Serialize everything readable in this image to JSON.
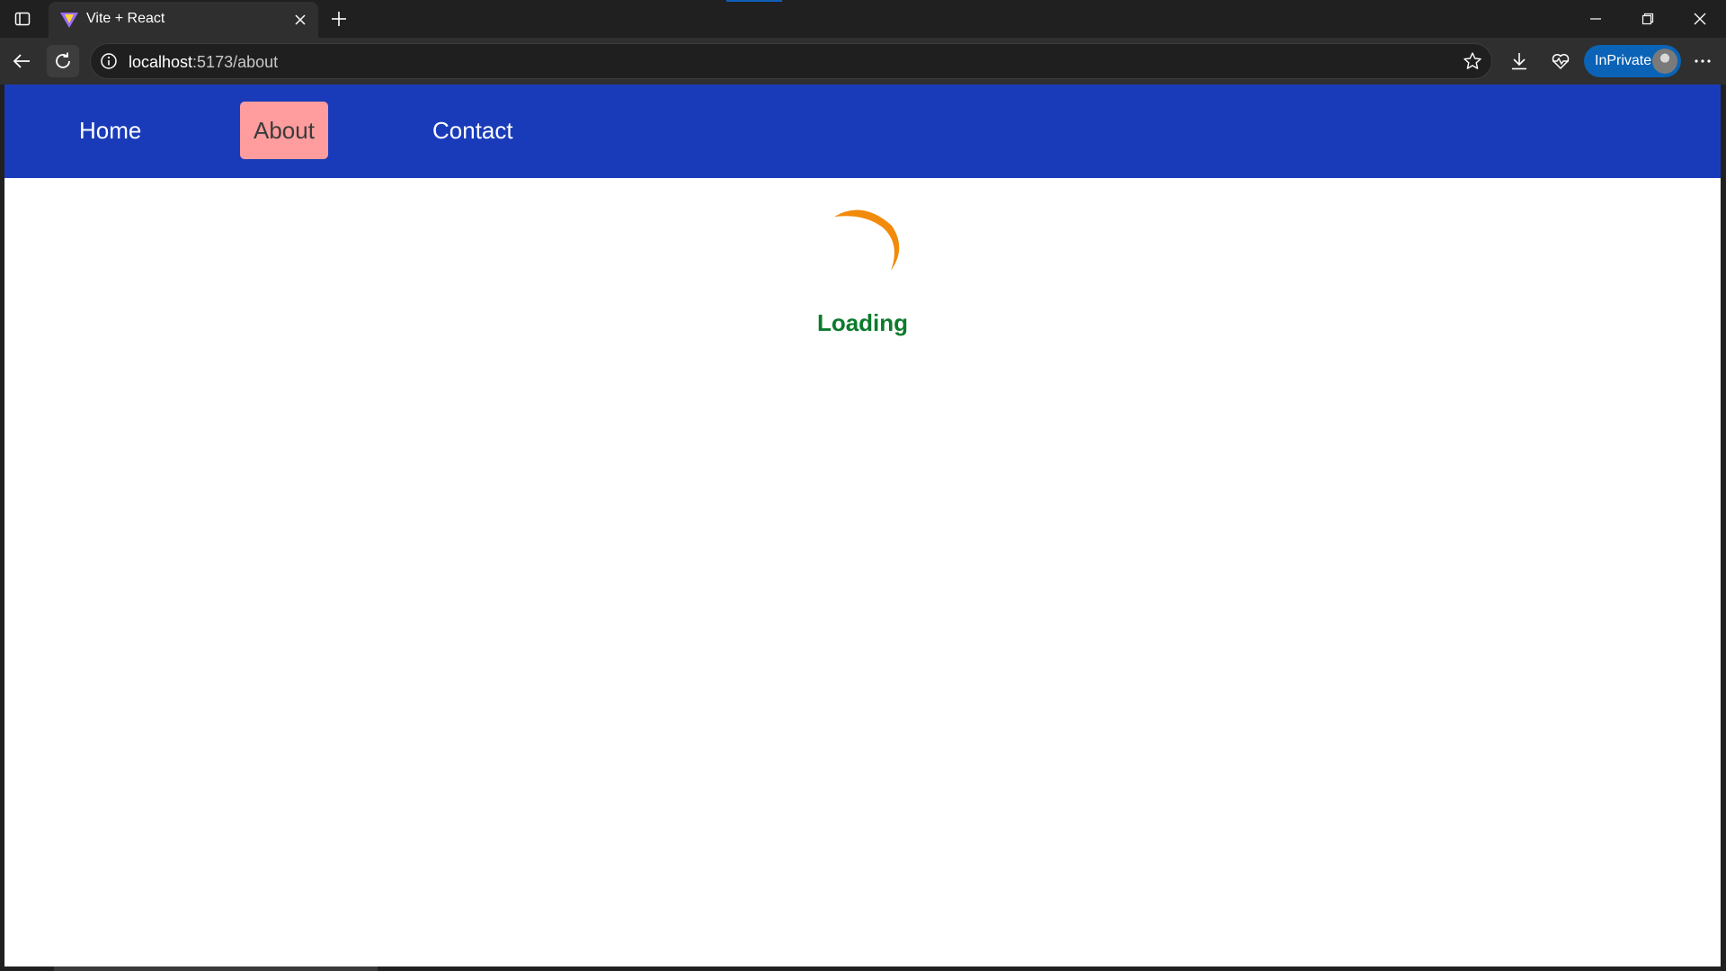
{
  "browser": {
    "tab": {
      "title": "Vite + React"
    },
    "address_bar": {
      "host": "localhost",
      "path": ":5173/about"
    },
    "profile": {
      "label": "InPrivate"
    }
  },
  "page": {
    "nav": {
      "items": [
        {
          "label": "Home",
          "active": false
        },
        {
          "label": "About",
          "active": true
        },
        {
          "label": "Contact",
          "active": false
        }
      ]
    },
    "status": {
      "loading_text": "Loading"
    }
  },
  "colors": {
    "nav_background": "#1a3bb9",
    "active_nav_item": "#ff9d9e",
    "spinner": "#f28a0a",
    "loading_text": "#0b7a2c",
    "inprivate_badge": "#0a63b6"
  },
  "icons": {
    "tab_actions": "tab-actions-icon",
    "favicon": "vite-logo-icon",
    "tab_close": "close-icon",
    "new_tab": "plus-icon",
    "back": "back-arrow-icon",
    "reload": "reload-icon",
    "site_info": "info-icon",
    "favorite": "star-icon",
    "downloads": "download-icon",
    "performance": "heartbeat-icon",
    "more": "more-icon",
    "minimize": "minimize-icon",
    "restore": "restore-icon",
    "close_window": "close-window-icon",
    "spinner": "spinner-icon"
  }
}
